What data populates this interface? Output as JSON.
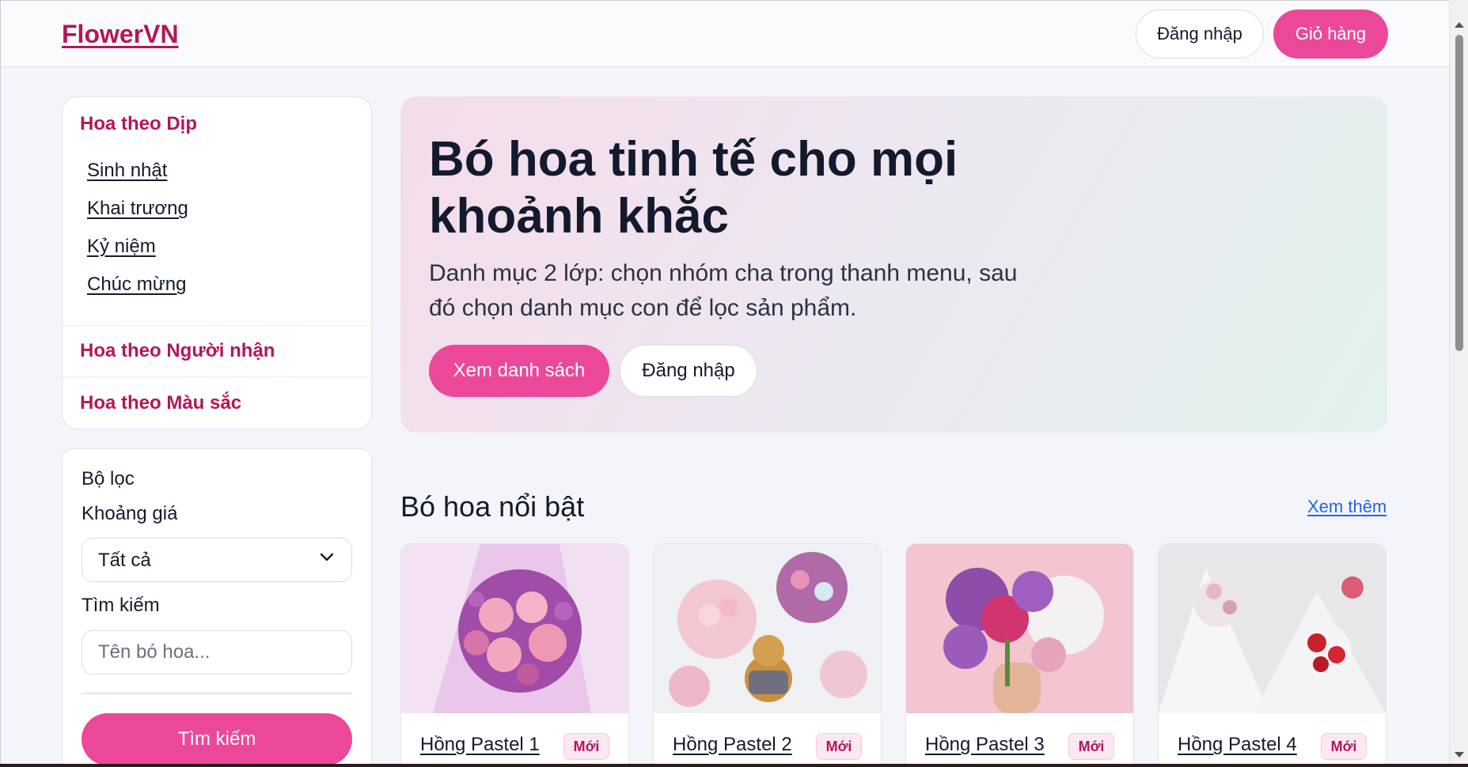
{
  "header": {
    "logo": "FlowerVN",
    "login_label": "Đăng nhập",
    "cart_label": "Giỏ hàng"
  },
  "categories": [
    {
      "title": "Hoa theo Dịp",
      "items": [
        "Sinh nhật",
        "Khai trương",
        "Kỷ niệm",
        "Chúc mừng"
      ]
    },
    {
      "title": "Hoa theo Người nhận",
      "items": []
    },
    {
      "title": "Hoa theo Màu sắc",
      "items": []
    }
  ],
  "filter": {
    "title": "Bộ lọc",
    "price_label": "Khoảng giá",
    "price_value": "Tất cả",
    "search_label": "Tìm kiếm",
    "search_placeholder": "Tên bó hoa...",
    "search_button": "Tìm kiếm"
  },
  "hero": {
    "title": "Bó hoa tinh tế cho mọi khoảnh khắc",
    "description": "Danh mục 2 lớp: chọn nhóm cha trong thanh menu, sau đó chọn danh mục con để lọc sản phẩm.",
    "primary_button": "Xem danh sách",
    "secondary_button": "Đăng nhập"
  },
  "featured": {
    "title": "Bó hoa nổi bật",
    "see_more": "Xem thêm",
    "products": [
      {
        "name": "Hồng Pastel 1",
        "badge": "Mới"
      },
      {
        "name": "Hồng Pastel 2",
        "badge": "Mới"
      },
      {
        "name": "Hồng Pastel 3",
        "badge": "Mới"
      },
      {
        "name": "Hồng Pastel 4",
        "badge": "Mới"
      }
    ]
  },
  "colors": {
    "brand": "#b3165b",
    "accent": "#ec4899",
    "link": "#2563eb"
  }
}
